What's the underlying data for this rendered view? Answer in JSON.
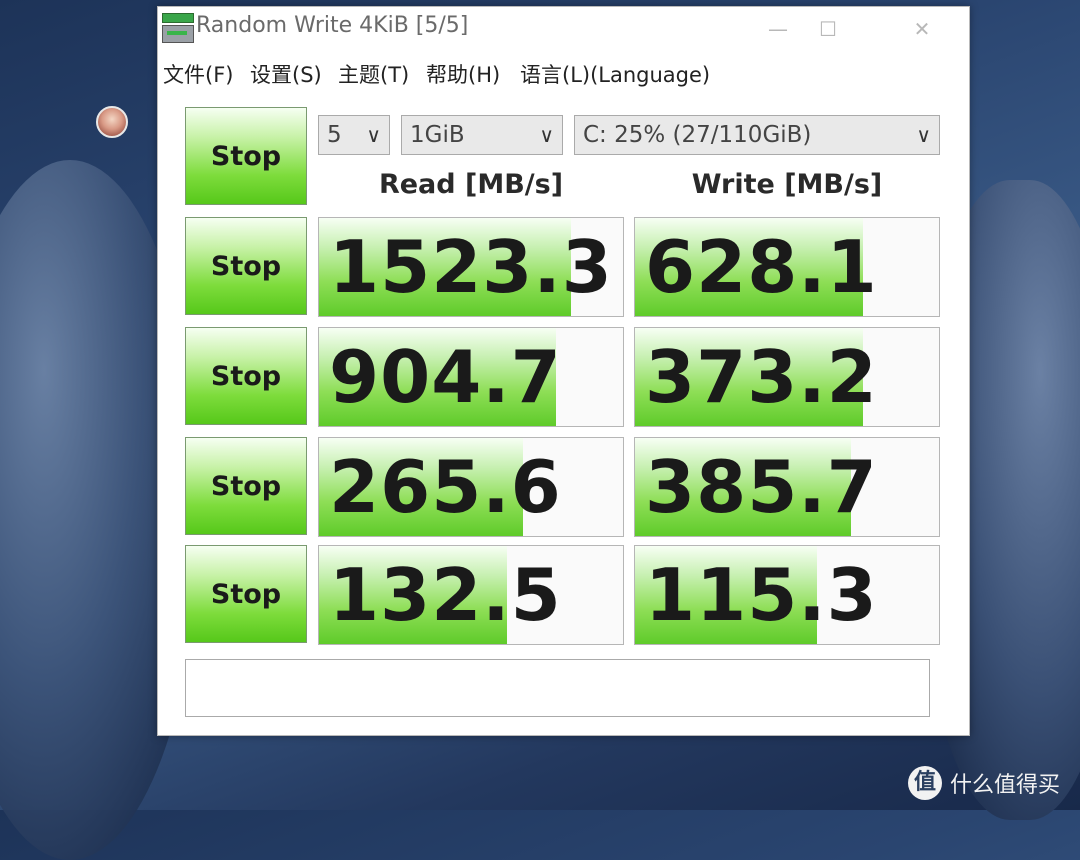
{
  "window": {
    "title": "Random Write 4KiB [5/5]",
    "minimize_glyph": "—",
    "maximize_glyph": "☐",
    "close_glyph": "✕"
  },
  "menu": [
    {
      "label": "文件(F)"
    },
    {
      "label": "设置(S)"
    },
    {
      "label": "主题(T)"
    },
    {
      "label": "帮助(H)"
    },
    {
      "label": "语言(L)(Language)"
    }
  ],
  "controls": {
    "all_button_label": "Stop",
    "count_value": "5",
    "size_value": "1GiB",
    "drive_value": "C: 25% (27/110GiB)",
    "chevron_glyph": "∨"
  },
  "headers": {
    "read": "Read [MB/s]",
    "write": "Write [MB/s]"
  },
  "rows": [
    {
      "button": "Stop",
      "read": "1523.3",
      "write": "628.1",
      "read_fill": 0.83,
      "write_fill": 0.75
    },
    {
      "button": "Stop",
      "read": "904.7",
      "write": "373.2",
      "read_fill": 0.78,
      "write_fill": 0.75
    },
    {
      "button": "Stop",
      "read": "265.6",
      "write": "385.7",
      "read_fill": 0.67,
      "write_fill": 0.71
    },
    {
      "button": "Stop",
      "read": "132.5",
      "write": "115.3",
      "read_fill": 0.62,
      "write_fill": 0.6
    }
  ],
  "status_text": "",
  "watermark": {
    "logo": "值",
    "text": "什么值得买"
  }
}
